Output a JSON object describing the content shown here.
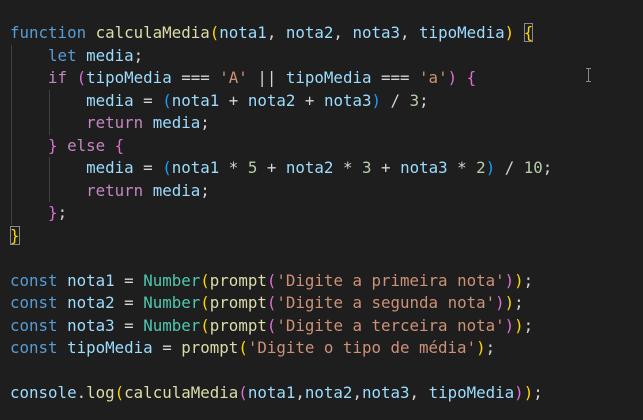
{
  "editor": {
    "lines": [
      {
        "tokens": [
          {
            "t": "function",
            "c": "kw"
          },
          {
            "t": " ",
            "c": "op"
          },
          {
            "t": "calculaMedia",
            "c": "fn"
          },
          {
            "t": "(",
            "c": "p0"
          },
          {
            "t": "nota1",
            "c": "var"
          },
          {
            "t": ", ",
            "c": "op"
          },
          {
            "t": "nota2",
            "c": "var"
          },
          {
            "t": ", ",
            "c": "op"
          },
          {
            "t": "nota3",
            "c": "var"
          },
          {
            "t": ", ",
            "c": "op"
          },
          {
            "t": "tipoMedia",
            "c": "var"
          },
          {
            "t": ")",
            "c": "p0"
          },
          {
            "t": " ",
            "c": "op"
          },
          {
            "t": "{",
            "c": "p0 bracket-match"
          }
        ]
      },
      {
        "guides": [
          1
        ],
        "tokens": [
          {
            "t": "    ",
            "c": "op"
          },
          {
            "t": "let",
            "c": "kw"
          },
          {
            "t": " ",
            "c": "op"
          },
          {
            "t": "media",
            "c": "var"
          },
          {
            "t": ";",
            "c": "op"
          }
        ]
      },
      {
        "guides": [
          1
        ],
        "tokens": [
          {
            "t": "    ",
            "c": "op"
          },
          {
            "t": "if",
            "c": "ctl"
          },
          {
            "t": " ",
            "c": "op"
          },
          {
            "t": "(",
            "c": "p1"
          },
          {
            "t": "tipoMedia",
            "c": "var"
          },
          {
            "t": " === ",
            "c": "op"
          },
          {
            "t": "'A'",
            "c": "str"
          },
          {
            "t": " || ",
            "c": "op"
          },
          {
            "t": "tipoMedia",
            "c": "var"
          },
          {
            "t": " === ",
            "c": "op"
          },
          {
            "t": "'a'",
            "c": "str"
          },
          {
            "t": ")",
            "c": "p1"
          },
          {
            "t": " ",
            "c": "op"
          },
          {
            "t": "{",
            "c": "p1"
          }
        ]
      },
      {
        "guides": [
          1,
          2
        ],
        "tokens": [
          {
            "t": "        ",
            "c": "op"
          },
          {
            "t": "media",
            "c": "var"
          },
          {
            "t": " = ",
            "c": "op"
          },
          {
            "t": "(",
            "c": "p2"
          },
          {
            "t": "nota1",
            "c": "var"
          },
          {
            "t": " + ",
            "c": "op"
          },
          {
            "t": "nota2",
            "c": "var"
          },
          {
            "t": " + ",
            "c": "op"
          },
          {
            "t": "nota3",
            "c": "var"
          },
          {
            "t": ")",
            "c": "p2"
          },
          {
            "t": " / ",
            "c": "op"
          },
          {
            "t": "3",
            "c": "num"
          },
          {
            "t": ";",
            "c": "op"
          }
        ]
      },
      {
        "guides": [
          1,
          2
        ],
        "tokens": [
          {
            "t": "        ",
            "c": "op"
          },
          {
            "t": "return",
            "c": "ctl"
          },
          {
            "t": " ",
            "c": "op"
          },
          {
            "t": "media",
            "c": "var"
          },
          {
            "t": ";",
            "c": "op"
          }
        ]
      },
      {
        "guides": [
          1
        ],
        "tokens": [
          {
            "t": "    ",
            "c": "op"
          },
          {
            "t": "}",
            "c": "p1"
          },
          {
            "t": " ",
            "c": "op"
          },
          {
            "t": "else",
            "c": "ctl"
          },
          {
            "t": " ",
            "c": "op"
          },
          {
            "t": "{",
            "c": "p1"
          }
        ]
      },
      {
        "guides": [
          1,
          2
        ],
        "tokens": [
          {
            "t": "        ",
            "c": "op"
          },
          {
            "t": "media",
            "c": "var"
          },
          {
            "t": " = ",
            "c": "op"
          },
          {
            "t": "(",
            "c": "p2"
          },
          {
            "t": "nota1",
            "c": "var"
          },
          {
            "t": " * ",
            "c": "op"
          },
          {
            "t": "5",
            "c": "num"
          },
          {
            "t": " + ",
            "c": "op"
          },
          {
            "t": "nota2",
            "c": "var"
          },
          {
            "t": " * ",
            "c": "op"
          },
          {
            "t": "3",
            "c": "num"
          },
          {
            "t": " + ",
            "c": "op"
          },
          {
            "t": "nota3",
            "c": "var"
          },
          {
            "t": " * ",
            "c": "op"
          },
          {
            "t": "2",
            "c": "num"
          },
          {
            "t": ")",
            "c": "p2"
          },
          {
            "t": " / ",
            "c": "op"
          },
          {
            "t": "10",
            "c": "num"
          },
          {
            "t": ";",
            "c": "op"
          }
        ]
      },
      {
        "guides": [
          1,
          2
        ],
        "tokens": [
          {
            "t": "        ",
            "c": "op"
          },
          {
            "t": "return",
            "c": "ctl"
          },
          {
            "t": " ",
            "c": "op"
          },
          {
            "t": "media",
            "c": "var"
          },
          {
            "t": ";",
            "c": "op"
          }
        ]
      },
      {
        "guides": [
          1
        ],
        "tokens": [
          {
            "t": "    ",
            "c": "op"
          },
          {
            "t": "}",
            "c": "p1"
          },
          {
            "t": ";",
            "c": "op"
          }
        ]
      },
      {
        "tokens": [
          {
            "t": "}",
            "c": "p0 bracket-match"
          }
        ]
      },
      {
        "tokens": []
      },
      {
        "tokens": [
          {
            "t": "const",
            "c": "kw"
          },
          {
            "t": " ",
            "c": "op"
          },
          {
            "t": "nota1",
            "c": "var"
          },
          {
            "t": " = ",
            "c": "op"
          },
          {
            "t": "Number",
            "c": "cls"
          },
          {
            "t": "(",
            "c": "p0"
          },
          {
            "t": "prompt",
            "c": "fn"
          },
          {
            "t": "(",
            "c": "p1"
          },
          {
            "t": "'Digite a primeira nota'",
            "c": "str"
          },
          {
            "t": ")",
            "c": "p1"
          },
          {
            "t": ")",
            "c": "p0"
          },
          {
            "t": ";",
            "c": "op"
          }
        ]
      },
      {
        "tokens": [
          {
            "t": "const",
            "c": "kw"
          },
          {
            "t": " ",
            "c": "op"
          },
          {
            "t": "nota2",
            "c": "var"
          },
          {
            "t": " = ",
            "c": "op"
          },
          {
            "t": "Number",
            "c": "cls"
          },
          {
            "t": "(",
            "c": "p0"
          },
          {
            "t": "prompt",
            "c": "fn"
          },
          {
            "t": "(",
            "c": "p1"
          },
          {
            "t": "'Digite a segunda nota'",
            "c": "str"
          },
          {
            "t": ")",
            "c": "p1"
          },
          {
            "t": ")",
            "c": "p0"
          },
          {
            "t": ";",
            "c": "op"
          }
        ]
      },
      {
        "tokens": [
          {
            "t": "const",
            "c": "kw"
          },
          {
            "t": " ",
            "c": "op"
          },
          {
            "t": "nota3",
            "c": "var"
          },
          {
            "t": " = ",
            "c": "op"
          },
          {
            "t": "Number",
            "c": "cls"
          },
          {
            "t": "(",
            "c": "p0"
          },
          {
            "t": "prompt",
            "c": "fn"
          },
          {
            "t": "(",
            "c": "p1"
          },
          {
            "t": "'Digite a terceira nota'",
            "c": "str"
          },
          {
            "t": ")",
            "c": "p1"
          },
          {
            "t": ")",
            "c": "p0"
          },
          {
            "t": ";",
            "c": "op"
          }
        ]
      },
      {
        "tokens": [
          {
            "t": "const",
            "c": "kw"
          },
          {
            "t": " ",
            "c": "op"
          },
          {
            "t": "tipoMedia",
            "c": "var"
          },
          {
            "t": " = ",
            "c": "op"
          },
          {
            "t": "prompt",
            "c": "fn"
          },
          {
            "t": "(",
            "c": "p0"
          },
          {
            "t": "'Digite o tipo de média'",
            "c": "str"
          },
          {
            "t": ")",
            "c": "p0"
          },
          {
            "t": ";",
            "c": "op"
          }
        ]
      },
      {
        "tokens": []
      },
      {
        "tokens": [
          {
            "t": "console",
            "c": "var"
          },
          {
            "t": ".",
            "c": "op"
          },
          {
            "t": "log",
            "c": "fn"
          },
          {
            "t": "(",
            "c": "p0"
          },
          {
            "t": "calculaMedia",
            "c": "fn"
          },
          {
            "t": "(",
            "c": "p1"
          },
          {
            "t": "nota1",
            "c": "var"
          },
          {
            "t": ",",
            "c": "op"
          },
          {
            "t": "nota2",
            "c": "var"
          },
          {
            "t": ",",
            "c": "op"
          },
          {
            "t": "nota3",
            "c": "var"
          },
          {
            "t": ", ",
            "c": "op"
          },
          {
            "t": "tipoMedia",
            "c": "var"
          },
          {
            "t": ")",
            "c": "p1"
          },
          {
            "t": ")",
            "c": "p0"
          },
          {
            "t": ";",
            "c": "op"
          }
        ]
      }
    ]
  }
}
